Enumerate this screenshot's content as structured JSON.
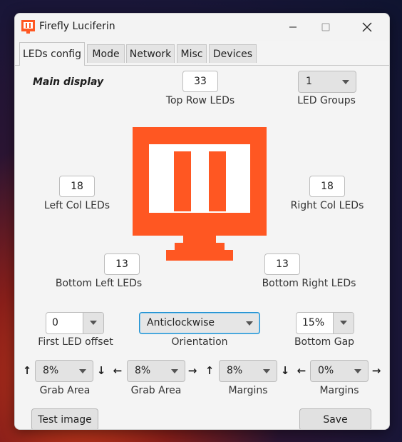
{
  "window": {
    "title": "Firefly Luciferin",
    "accent_color": "#ff5722"
  },
  "tabs": [
    {
      "label": "LEDs config",
      "active": true
    },
    {
      "label": "Mode",
      "active": false
    },
    {
      "label": "Network",
      "active": false
    },
    {
      "label": "Misc",
      "active": false
    },
    {
      "label": "Devices",
      "active": false
    }
  ],
  "leds": {
    "display_label": "Main display",
    "top_row": {
      "value": "33",
      "label": "Top Row LEDs"
    },
    "led_groups": {
      "value": "1",
      "label": "LED Groups"
    },
    "left_col": {
      "value": "18",
      "label": "Left Col LEDs"
    },
    "right_col": {
      "value": "18",
      "label": "Right Col LEDs"
    },
    "bottom_left": {
      "value": "13",
      "label": "Bottom Left LEDs"
    },
    "bottom_right": {
      "value": "13",
      "label": "Bottom Right LEDs"
    },
    "first_led_offset": {
      "value": "0",
      "label": "First LED offset"
    },
    "orientation": {
      "value": "Anticlockwise",
      "label": "Orientation"
    },
    "bottom_gap": {
      "value": "15%",
      "label": "Bottom Gap"
    },
    "grab_area_v": {
      "value": "8%",
      "label": "Grab Area"
    },
    "grab_area_h": {
      "value": "8%",
      "label": "Grab Area"
    },
    "margins_v": {
      "value": "8%",
      "label": "Margins"
    },
    "margins_h": {
      "value": "0%",
      "label": "Margins"
    }
  },
  "icons": {
    "up": "↑",
    "down": "↓",
    "left": "←",
    "right": "→"
  },
  "buttons": {
    "test_image": "Test image",
    "save": "Save"
  }
}
